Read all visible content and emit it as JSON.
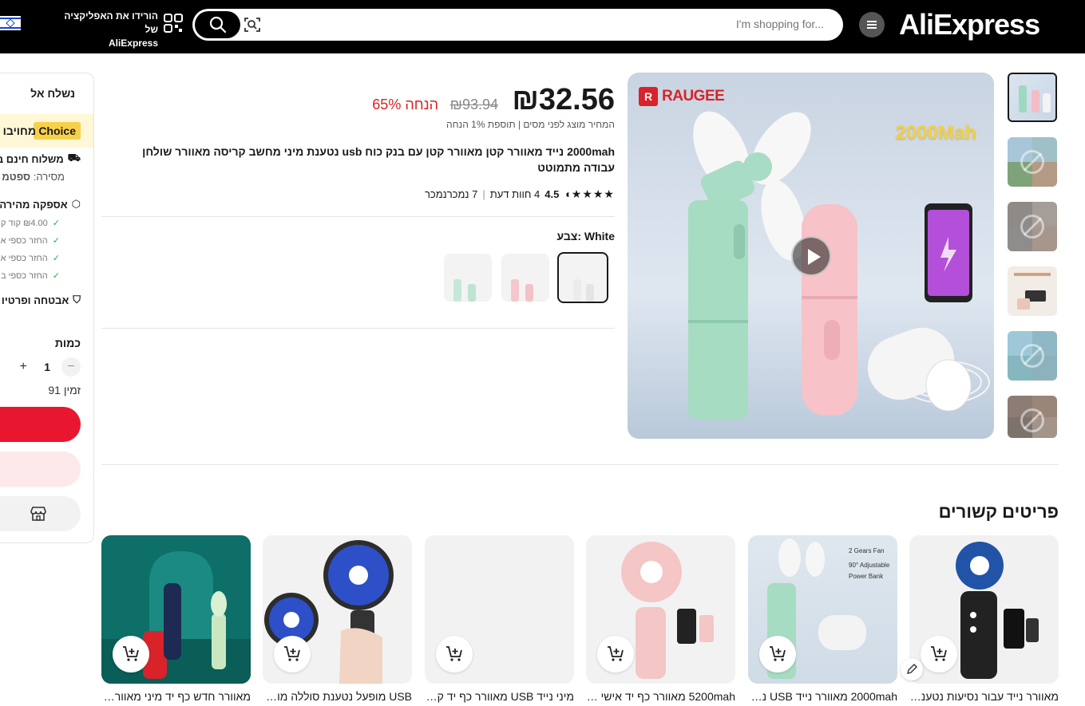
{
  "header": {
    "logo": "AliExpress",
    "search_placeholder": "I'm shopping for...",
    "app_promo_line1": "הורידו את האפליקציה של",
    "app_promo_line2": "AliExpress"
  },
  "gallery": {
    "brand": "RAUGEE",
    "capacity_label": "2000Mah",
    "thumb_count": 6
  },
  "product": {
    "price": "₪32.56",
    "old_price": "₪93.94",
    "discount": "65% הנחה",
    "price_note": "המחיר מוצג לפני מסים | תוספת 1% הנחה",
    "title": "2000mah נייד מאוורר קטן מאוורר קטן עם בנק כוח usb נטענת מיני מחשב קריסה מאוורר שולחן עבודה מתמוטט",
    "rating": "4.5",
    "reviews": "4 חוות דעת",
    "sold": "7 נמכרנמכר",
    "color_label": "צבע: White",
    "colors": [
      "White",
      "Pink",
      "Green"
    ]
  },
  "side": {
    "ship_to": "נשלח אל",
    "choice_badge": "Choice",
    "choice_text": "מחויבו",
    "free_shipping": "משלוח חינם ב",
    "delivery_prefix": "מסירה:",
    "delivery_value": "ספטמ",
    "fast_delivery": "אספקה מהירה",
    "checks": [
      "₪4.00 קוד קו",
      "החזר כספי אם",
      "החזר כספי אם",
      "החזר כספי ב"
    ],
    "security": "אבטחה ופרטיו",
    "qty_label": "כמות",
    "qty_value": "1",
    "qty_minus": "−",
    "qty_plus": "+",
    "available": "91 זמין"
  },
  "related": {
    "title": "פריטים קשורים",
    "items": [
      {
        "title": "מאוורר נייד עבור נסיעות נטענת מ..."
      },
      {
        "title": "2000mah מאוורר נייד USB נט..."
      },
      {
        "title": "5200mah מאוורר כף יד אישי מ..."
      },
      {
        "title": "מיני נייד USB מאוורר כף יד קטן..."
      },
      {
        "title": "USB מופעל נטענת סוללה מופעל..."
      },
      {
        "title": "מאוורר חדש כף יד מיני מאוורר ק..."
      }
    ]
  }
}
